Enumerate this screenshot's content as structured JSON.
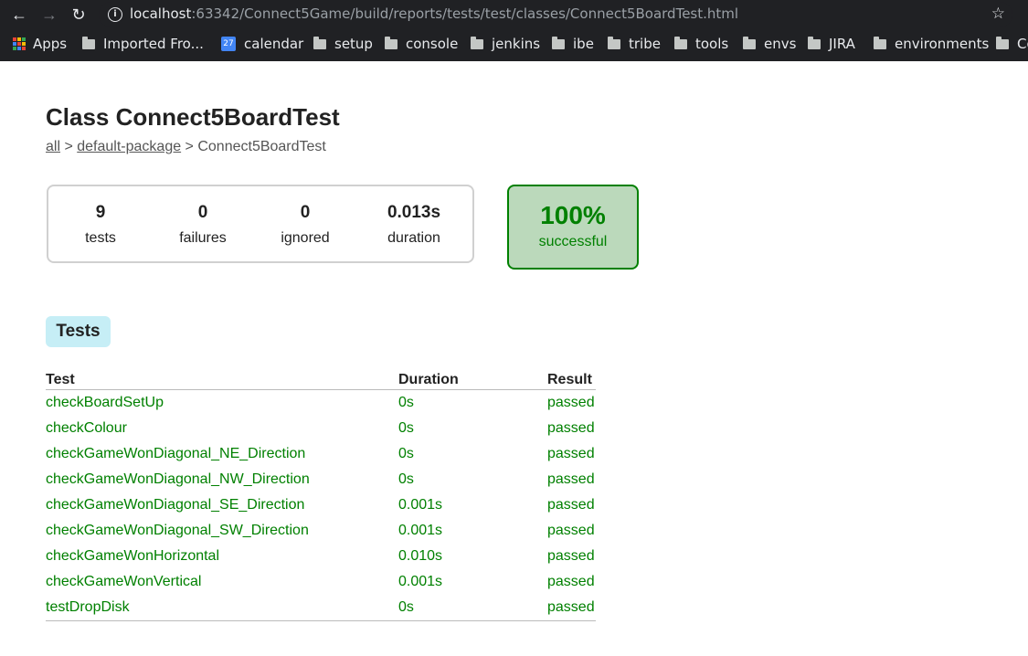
{
  "browser": {
    "url_host": "localhost",
    "url_rest": ":63342/Connect5Game/build/reports/tests/test/classes/Connect5BoardTest.html",
    "bookmarks": [
      {
        "label": "Apps",
        "icon": "apps-grid-icon"
      },
      {
        "label": "Imported Fro...",
        "icon": "folder-icon"
      },
      {
        "label": "calendar",
        "icon": "calendar-icon",
        "icon_text": "27"
      },
      {
        "label": "setup",
        "icon": "folder-icon"
      },
      {
        "label": "console",
        "icon": "folder-icon"
      },
      {
        "label": "jenkins",
        "icon": "folder-icon"
      },
      {
        "label": "ibe",
        "icon": "folder-icon"
      },
      {
        "label": "tribe",
        "icon": "folder-icon"
      },
      {
        "label": "tools",
        "icon": "folder-icon"
      },
      {
        "label": "envs",
        "icon": "folder-icon"
      },
      {
        "label": "JIRA",
        "icon": "folder-icon"
      },
      {
        "label": "environments",
        "icon": "folder-icon"
      },
      {
        "label": "Co",
        "icon": "folder-icon"
      }
    ]
  },
  "page": {
    "title": "Class Connect5BoardTest",
    "breadcrumb": {
      "all": "all",
      "sep1": " > ",
      "package": "default-package",
      "sep2": " > ",
      "current": "Connect5BoardTest"
    }
  },
  "summary": {
    "tests": "9",
    "tests_label": "tests",
    "failures": "0",
    "failures_label": "failures",
    "ignored": "0",
    "ignored_label": "ignored",
    "duration": "0.013s",
    "duration_label": "duration",
    "success_rate": "100%",
    "success_label": "successful"
  },
  "tabs": {
    "tests": "Tests"
  },
  "table": {
    "headers": {
      "test": "Test",
      "duration": "Duration",
      "result": "Result"
    },
    "rows": [
      {
        "test": "checkBoardSetUp",
        "duration": "0s",
        "result": "passed"
      },
      {
        "test": "checkColour",
        "duration": "0s",
        "result": "passed"
      },
      {
        "test": "checkGameWonDiagonal_NE_Direction",
        "duration": "0s",
        "result": "passed"
      },
      {
        "test": "checkGameWonDiagonal_NW_Direction",
        "duration": "0s",
        "result": "passed"
      },
      {
        "test": "checkGameWonDiagonal_SE_Direction",
        "duration": "0.001s",
        "result": "passed"
      },
      {
        "test": "checkGameWonDiagonal_SW_Direction",
        "duration": "0.001s",
        "result": "passed"
      },
      {
        "test": "checkGameWonHorizontal",
        "duration": "0.010s",
        "result": "passed"
      },
      {
        "test": "checkGameWonVertical",
        "duration": "0.001s",
        "result": "passed"
      },
      {
        "test": "testDropDisk",
        "duration": "0s",
        "result": "passed"
      }
    ]
  },
  "colors": {
    "success": "#008000",
    "success_bg": "#bbd9bb",
    "tab_bg": "#c6eef6",
    "chrome_bg": "#202124"
  }
}
